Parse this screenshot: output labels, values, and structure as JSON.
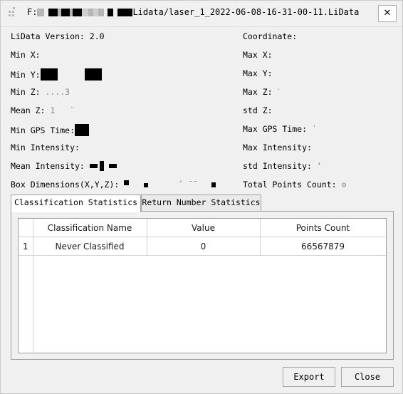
{
  "window": {
    "title_prefix": "F:",
    "title_suffix": "Lidata/laser_1_2022-06-08-16-31-00-11.LiData",
    "close_icon": "close-icon",
    "close_glyph": "✕",
    "grip_icon": "resize-grip-icon",
    "bg_color": "#f0f0f0",
    "border_color": "#c8c8c8"
  },
  "info": {
    "left": [
      {
        "label": "LiData Version:",
        "value": "2.0",
        "redacted": false
      },
      {
        "label": "Min X:",
        "value": "",
        "redacted": true
      },
      {
        "label": "Min Y:",
        "value": "",
        "redacted": true
      },
      {
        "label": "Min Z:",
        "value": "",
        "redacted": true
      },
      {
        "label": "Mean Z:",
        "value": "",
        "redacted": true
      },
      {
        "label": "Min GPS Time:",
        "value": "",
        "redacted": true
      },
      {
        "label": "Min Intensity:",
        "value": "",
        "redacted": true
      },
      {
        "label": "Mean Intensity:",
        "value": "",
        "redacted": true
      },
      {
        "label": "Box Dimensions(X,Y,Z):",
        "value": "",
        "redacted": true
      }
    ],
    "right": [
      {
        "label": "Coordinate:",
        "value": "",
        "redacted": true
      },
      {
        "label": "Max X:",
        "value": "",
        "redacted": true
      },
      {
        "label": "Max Y:",
        "value": "",
        "redacted": true
      },
      {
        "label": "Max Z:",
        "value": "",
        "redacted": true
      },
      {
        "label": "std Z:",
        "value": "",
        "redacted": true
      },
      {
        "label": "Max GPS Time:",
        "value": "",
        "redacted": true
      },
      {
        "label": "Max Intensity:",
        "value": "",
        "redacted": true
      },
      {
        "label": "std Intensity:",
        "value": "",
        "redacted": true
      },
      {
        "label": "Total Points Count:",
        "value": "",
        "redacted": true
      }
    ]
  },
  "tabs": [
    {
      "label": "Classification Statistics",
      "active": true
    },
    {
      "label": "Return Number Statistics",
      "active": false
    }
  ],
  "table": {
    "columns": [
      "",
      "Classification Name",
      "Value",
      "Points Count"
    ],
    "rows": [
      {
        "index": "1",
        "name": "Never Classified",
        "value": "0",
        "points_count": "66567879"
      }
    ]
  },
  "footer": {
    "export_label": "Export",
    "close_label": "Close"
  }
}
